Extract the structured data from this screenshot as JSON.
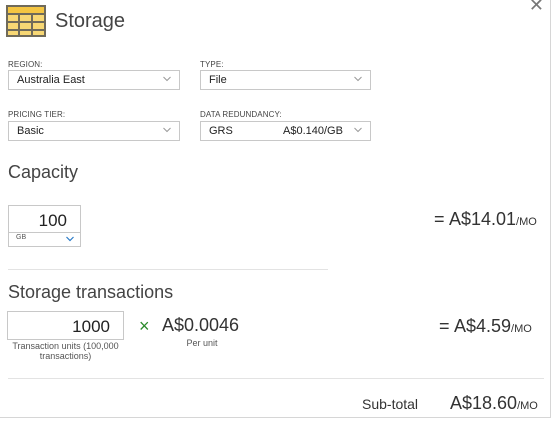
{
  "header": {
    "title": "Storage",
    "icon": "storage-table-icon",
    "close_icon": "close-icon"
  },
  "fields": {
    "region": {
      "label": "REGION:",
      "value": "Australia East"
    },
    "type": {
      "label": "TYPE:",
      "value": "File"
    },
    "pricing_tier": {
      "label": "PRICING TIER:",
      "value": "Basic"
    },
    "data_redundancy": {
      "label": "DATA REDUNDANCY:",
      "value": "GRS",
      "price": "A$0.140/GB"
    }
  },
  "capacity": {
    "heading": "Capacity",
    "quantity": "100",
    "unit": "GB",
    "equals": "=",
    "cost": "A$14.01",
    "per": "/MO"
  },
  "transactions": {
    "heading": "Storage transactions",
    "quantity": "1000",
    "unit_label": "Transaction units (100,000 transactions)",
    "times": "×",
    "unit_price": "A$0.0046",
    "unit_price_label": "Per unit",
    "equals": "=",
    "cost": "A$4.59",
    "per": "/MO"
  },
  "summary": {
    "label": "Sub-total",
    "amount": "A$18.60",
    "per": "/MO"
  },
  "colors": {
    "accent_green": "#2b8a2b",
    "icon_yellow": "#f2c94c",
    "icon_dark": "#7a6a3a"
  }
}
